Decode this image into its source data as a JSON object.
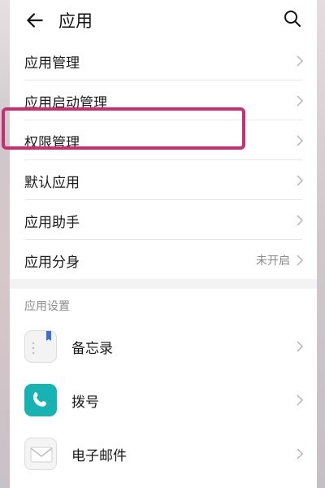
{
  "header": {
    "title": "应用"
  },
  "menu": [
    {
      "label": "应用管理"
    },
    {
      "label": "应用启动管理"
    },
    {
      "label": "权限管理"
    },
    {
      "label": "默认应用"
    },
    {
      "label": "应用助手"
    },
    {
      "label": "应用分身",
      "status": "未开启"
    }
  ],
  "section": {
    "label": "应用设置"
  },
  "apps": [
    {
      "label": "备忘录",
      "icon": "memo-icon"
    },
    {
      "label": "拨号",
      "icon": "phone-icon"
    },
    {
      "label": "电子邮件",
      "icon": "email-icon"
    }
  ],
  "colors": {
    "highlight": "#c72f72",
    "dial_icon": "#17b3b3"
  }
}
